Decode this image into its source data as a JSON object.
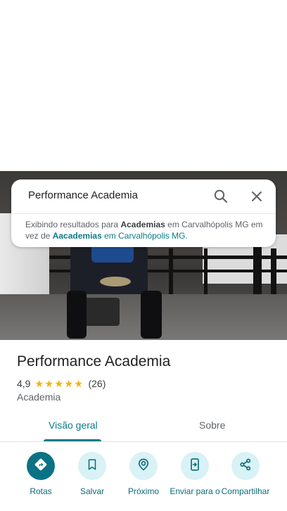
{
  "search": {
    "query": "Performance Academia",
    "suggestion_prefix": "Exibindo resultados para",
    "suggestion_term": "Academias",
    "suggestion_location": "em Carvalhópolis MG",
    "suggestion_middle": "em vez de",
    "suggestion_original_term": "Aacademias",
    "suggestion_original_location": "em Carvalhópolis MG."
  },
  "place": {
    "name": "Performance Academia",
    "rating": "4,9",
    "stars": 5,
    "review_count": "(26)",
    "category": "Academia"
  },
  "tabs": [
    {
      "label": "Visão geral",
      "active": true
    },
    {
      "label": "Sobre",
      "active": false
    }
  ],
  "actions": [
    {
      "label": "Rotas",
      "icon": "directions-icon"
    },
    {
      "label": "Salvar",
      "icon": "bookmark-icon"
    },
    {
      "label": "Próximo",
      "icon": "nearby-icon"
    },
    {
      "label": "Enviar para o",
      "icon": "send-to-phone-icon"
    },
    {
      "label": "Compartilhar",
      "icon": "share-icon"
    }
  ],
  "colors": {
    "accent": "#0b7a8a",
    "action_primary": "#0b7285",
    "action_secondary": "#d8f2f6",
    "star": "#f4b400"
  }
}
